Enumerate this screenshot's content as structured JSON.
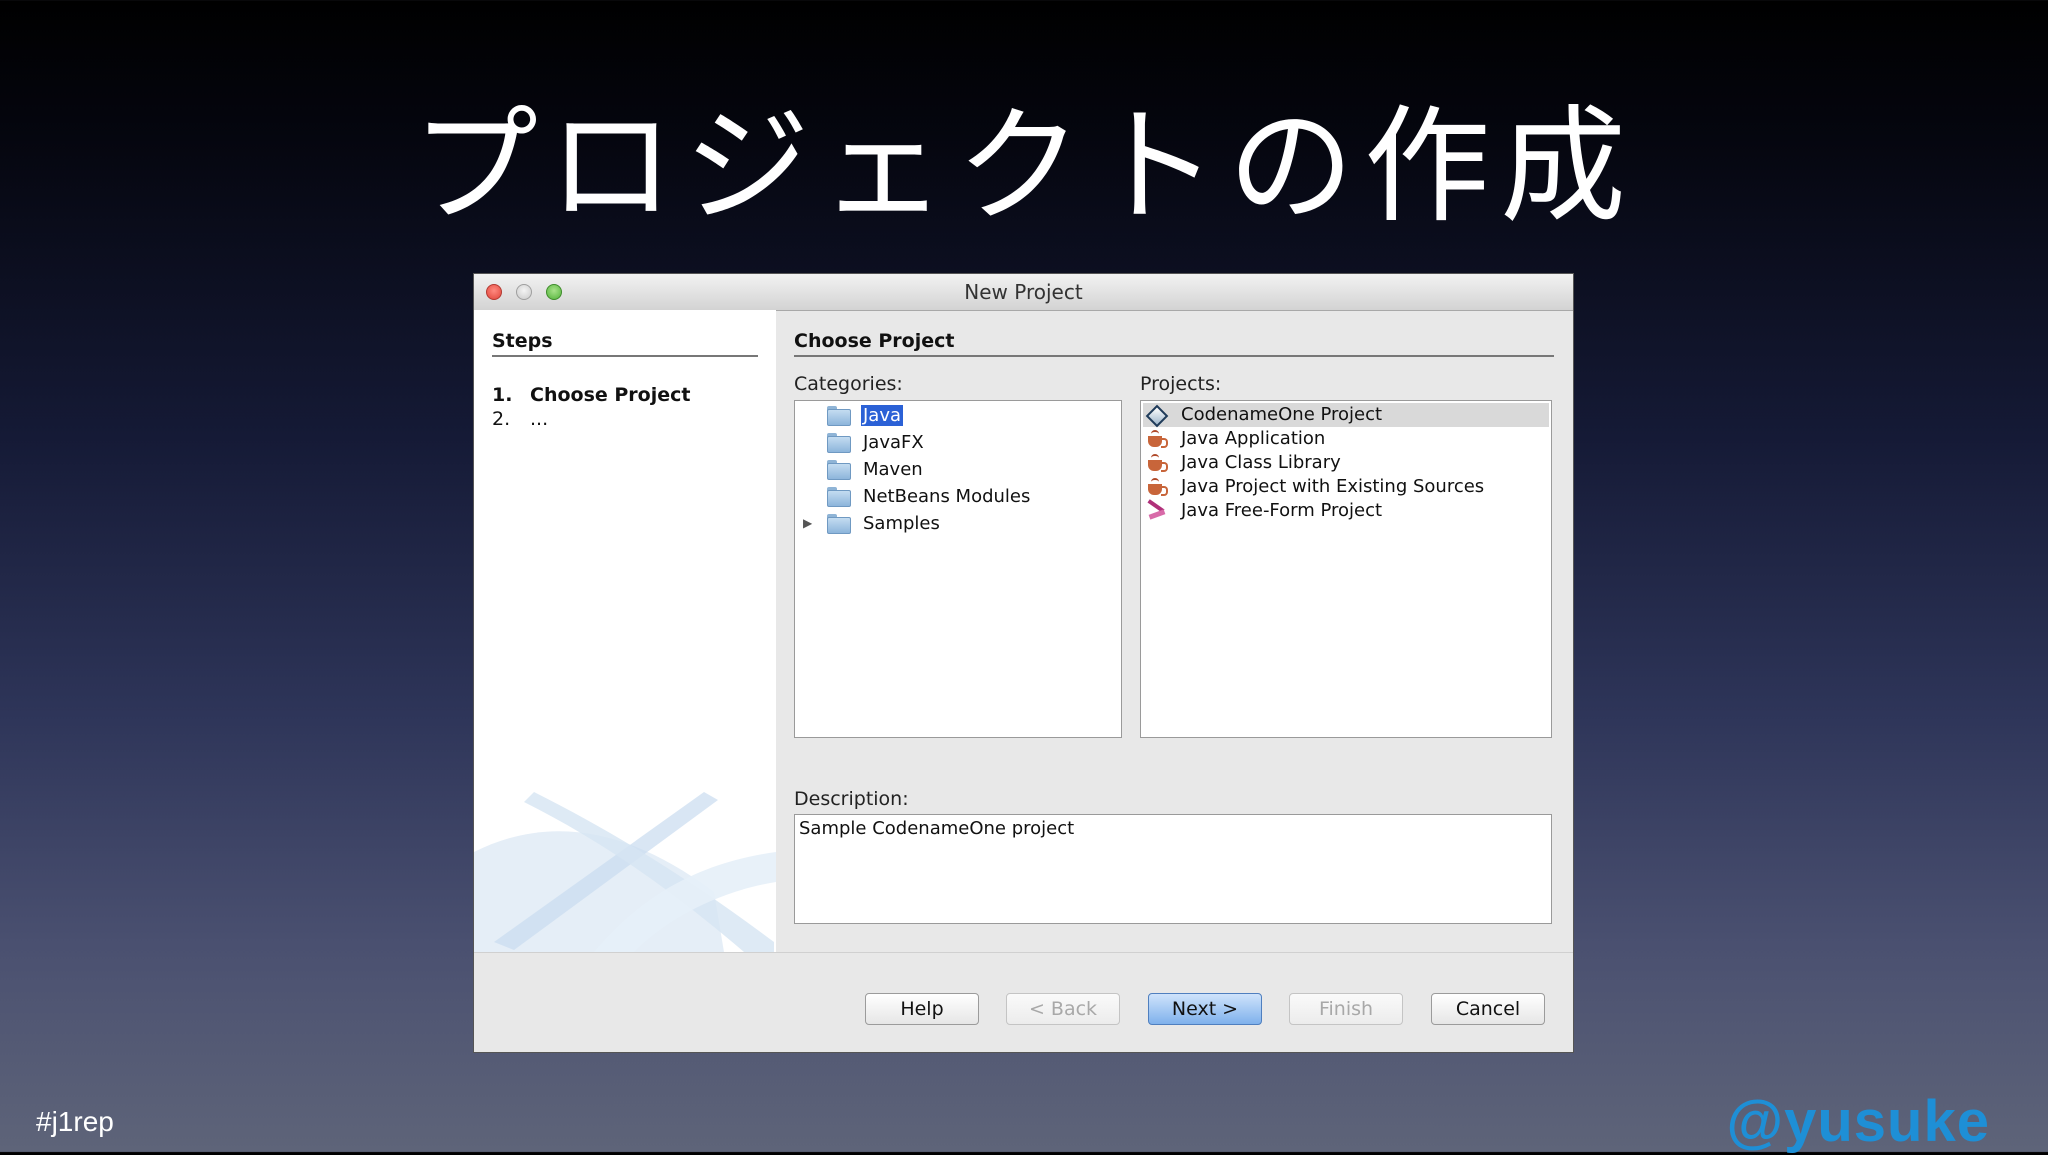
{
  "slide": {
    "title": "プロジェクトの作成",
    "hashtag": "#j1rep",
    "handle": "@yusuke"
  },
  "window": {
    "title": "New Project"
  },
  "steps": {
    "heading": "Steps",
    "items": [
      {
        "num": "1.",
        "label": "Choose Project",
        "active": true
      },
      {
        "num": "2.",
        "label": "...",
        "active": false
      }
    ]
  },
  "main": {
    "heading": "Choose Project",
    "categories_label": "Categories:",
    "categories": [
      {
        "label": "Java",
        "selected": true,
        "expandable": false
      },
      {
        "label": "JavaFX",
        "selected": false,
        "expandable": false
      },
      {
        "label": "Maven",
        "selected": false,
        "expandable": false
      },
      {
        "label": "NetBeans Modules",
        "selected": false,
        "expandable": false
      },
      {
        "label": "Samples",
        "selected": false,
        "expandable": true
      }
    ],
    "projects_label": "Projects:",
    "projects": [
      {
        "label": "CodenameOne Project",
        "icon": "codenameone-icon",
        "selected": true
      },
      {
        "label": "Java Application",
        "icon": "java-cup-icon",
        "selected": false
      },
      {
        "label": "Java Class Library",
        "icon": "java-cup-icon",
        "selected": false
      },
      {
        "label": "Java Project with Existing Sources",
        "icon": "java-cup-icon",
        "selected": false
      },
      {
        "label": "Java Free-Form Project",
        "icon": "free-form-icon",
        "selected": false
      }
    ],
    "description_label": "Description:",
    "description": "Sample CodenameOne project"
  },
  "buttons": {
    "help": "Help",
    "back": "< Back",
    "next": "Next >",
    "finish": "Finish",
    "cancel": "Cancel"
  },
  "colors": {
    "selection": "#2b61d6",
    "handle": "#1e8fd6"
  }
}
